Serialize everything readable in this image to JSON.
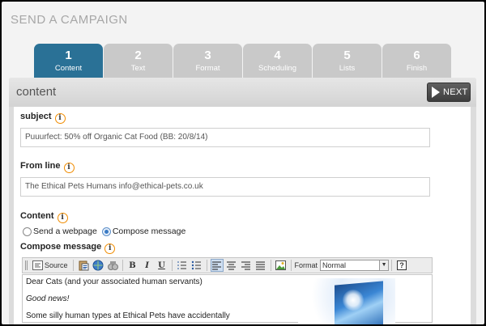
{
  "page": {
    "title": "SEND A CAMPAIGN"
  },
  "tabs": [
    {
      "num": "1",
      "label": "Content"
    },
    {
      "num": "2",
      "label": "Text"
    },
    {
      "num": "3",
      "label": "Format"
    },
    {
      "num": "4",
      "label": "Scheduling"
    },
    {
      "num": "5",
      "label": "Lists"
    },
    {
      "num": "6",
      "label": "Finish"
    }
  ],
  "active_tab": "Content",
  "section": {
    "title": "content",
    "next_label": "NEXT"
  },
  "form": {
    "subject_label": "subject",
    "subject_value": "Puuurfect: 50% off Organic Cat Food (BB: 20/8/14)",
    "from_label": "From line",
    "from_value": "The Ethical Pets Humans info@ethical-pets.co.uk",
    "content_label": "Content",
    "option_webpage": "Send a webpage",
    "option_compose": "Compose message",
    "selected_option": "Compose message",
    "compose_label": "Compose message",
    "info_glyph": "i"
  },
  "toolbar": {
    "source_label": "Source",
    "bold": "B",
    "italic": "I",
    "underline": "U",
    "format_label": "Format",
    "format_value": "Normal",
    "help": "?"
  },
  "editor": {
    "line1": "Dear Cats (and your associated human servants)",
    "line2": "Good news!",
    "line3": "Some silly human types at Ethical Pets have accidentally"
  },
  "icons": [
    "source-icon",
    "paste-text-icon",
    "spellcheck-icon",
    "find-icon",
    "numbered-list-icon",
    "bullet-list-icon",
    "align-left-icon",
    "align-center-icon",
    "align-right-icon",
    "justify-icon",
    "image-icon",
    "help-icon",
    "next-arrow-icon",
    "info-icon"
  ],
  "colors": {
    "active_tab": "#2a7196",
    "inactive_tab": "#c9c9c9",
    "info_ring": "#f08c00",
    "next_button": "#4a4a4a"
  }
}
